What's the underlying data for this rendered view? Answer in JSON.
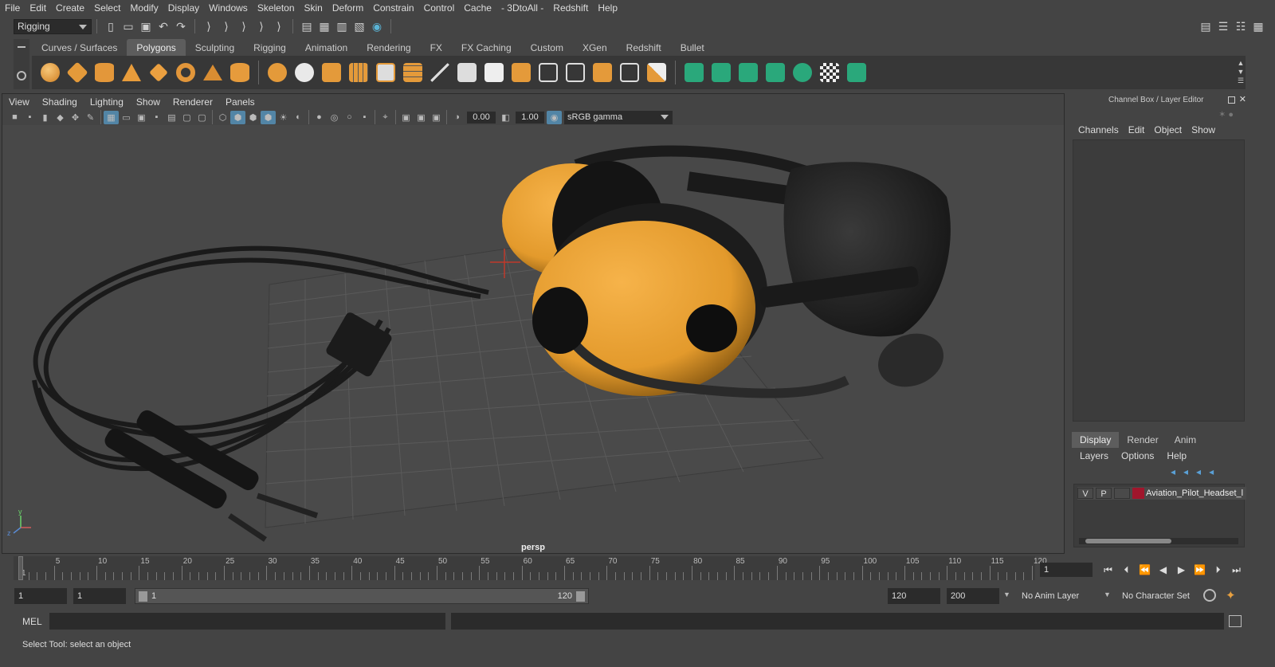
{
  "menubar": {
    "items": [
      "File",
      "Edit",
      "Create",
      "Select",
      "Modify",
      "Display",
      "Windows",
      "Skeleton",
      "Skin",
      "Deform",
      "Constrain",
      "Control",
      "Cache",
      "- 3DtoAll -",
      "Redshift",
      "Help"
    ]
  },
  "statusline": {
    "mode": "Rigging"
  },
  "shelf": {
    "tabs": [
      "Curves / Surfaces",
      "Polygons",
      "Sculpting",
      "Rigging",
      "Animation",
      "Rendering",
      "FX",
      "FX Caching",
      "Custom",
      "XGen",
      "Redshift",
      "Bullet"
    ],
    "active_tab": "Polygons"
  },
  "viewport": {
    "menu": [
      "View",
      "Shading",
      "Lighting",
      "Show",
      "Renderer",
      "Panels"
    ],
    "exposure": "0.00",
    "gamma": "1.00",
    "color_space": "sRGB gamma",
    "camera": "persp"
  },
  "channel_box": {
    "title": "Channel Box / Layer Editor",
    "menu": [
      "Channels",
      "Edit",
      "Object",
      "Show"
    ]
  },
  "layer_editor": {
    "tabs": [
      "Display",
      "Render",
      "Anim"
    ],
    "active_tab": "Display",
    "menu": [
      "Layers",
      "Options",
      "Help"
    ],
    "layers": [
      {
        "v": "V",
        "p": "P",
        "color": "#a0162c",
        "name": "Aviation_Pilot_Headset_l"
      }
    ]
  },
  "timeline": {
    "ticks": [
      "1",
      "5",
      "10",
      "15",
      "20",
      "25",
      "30",
      "35",
      "40",
      "45",
      "50",
      "55",
      "60",
      "65",
      "70",
      "75",
      "80",
      "85",
      "90",
      "95",
      "100",
      "105",
      "110",
      "115",
      "120"
    ],
    "current_frame": "1"
  },
  "range": {
    "start": "1",
    "anim_start": "1",
    "slider_start": "1",
    "slider_end": "120",
    "end": "120",
    "anim_end": "200",
    "anim_layer": "No Anim Layer",
    "character_set": "No Character Set"
  },
  "cmdline": {
    "label": "MEL"
  },
  "helpline": {
    "text": "Select Tool: select an object"
  }
}
